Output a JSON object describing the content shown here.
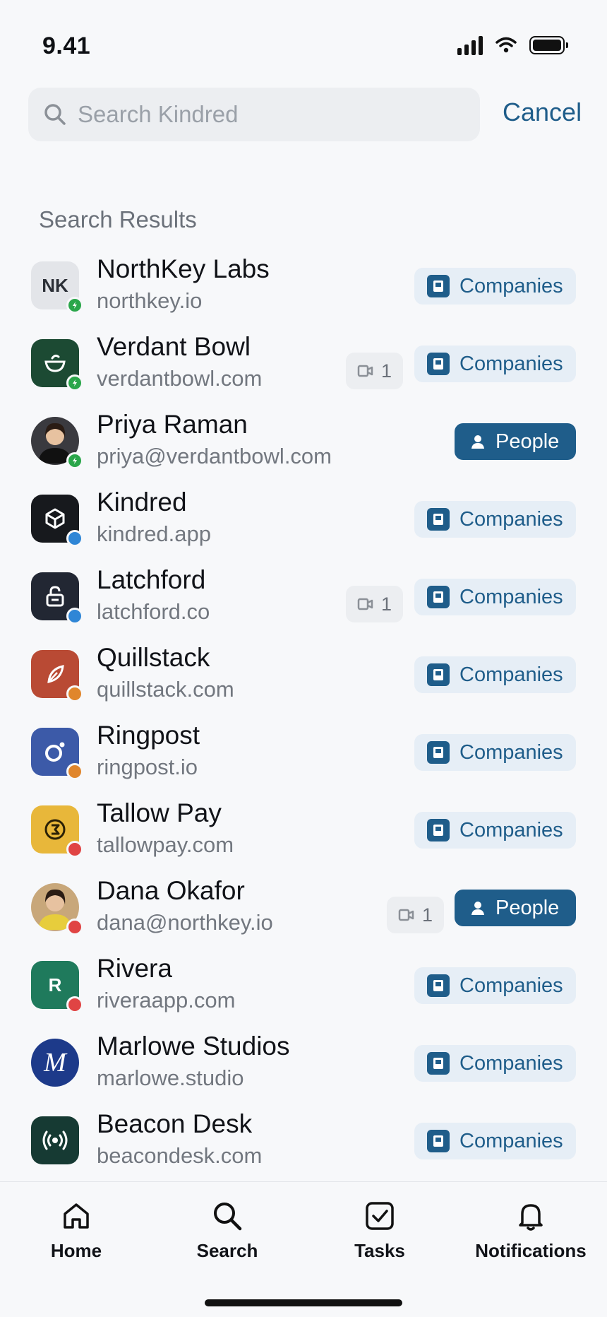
{
  "status_bar": {
    "time": "9.41"
  },
  "search": {
    "placeholder": "Search Kindred",
    "value": "",
    "cancel_label": "Cancel"
  },
  "section_title": "Search Results",
  "results": [
    {
      "title": "NorthKey Labs",
      "subtitle": "northkey.io",
      "tag": "Companies",
      "tag_type": "companies",
      "count": null,
      "avatar_text": "NK",
      "avatar_bg": "#e3e5e9",
      "status": "green"
    },
    {
      "title": "Verdant Bowl",
      "subtitle": "verdantbowl.com",
      "tag": "Companies",
      "tag_type": "companies",
      "count": "1",
      "avatar_icon": "bowl-icon",
      "avatar_bg": "#1c4a33",
      "status": "green"
    },
    {
      "title": "Priya Raman",
      "subtitle": "priya@verdantbowl.com",
      "tag": "People",
      "tag_type": "people",
      "count": null,
      "avatar_icon": "person-photo",
      "avatar_bg": "#3a3a3f",
      "status": "green"
    },
    {
      "title": "Kindred",
      "subtitle": "kindred.app",
      "tag": "Companies",
      "tag_type": "companies",
      "count": null,
      "avatar_icon": "cube-icon",
      "avatar_bg": "#17191d",
      "status": "blue"
    },
    {
      "title": "Latchford",
      "subtitle": "latchford.co",
      "tag": "Companies",
      "tag_type": "companies",
      "count": "1",
      "avatar_icon": "lock-icon",
      "avatar_bg": "#222733",
      "status": "blue"
    },
    {
      "title": "Quillstack",
      "subtitle": "quillstack.com",
      "tag": "Companies",
      "tag_type": "companies",
      "count": null,
      "avatar_icon": "quill-icon",
      "avatar_bg": "#b94a34",
      "status": "orange"
    },
    {
      "title": "Ringpost",
      "subtitle": "ringpost.io",
      "tag": "Companies",
      "tag_type": "companies",
      "count": null,
      "avatar_icon": "ring-icon",
      "avatar_bg": "#3c5aa8",
      "status": "orange"
    },
    {
      "title": "Tallow Pay",
      "subtitle": "tallowpay.com",
      "tag": "Companies",
      "tag_type": "companies",
      "count": null,
      "avatar_icon": "coin-icon",
      "avatar_bg": "#e8b73a",
      "status": "red"
    },
    {
      "title": "Dana Okafor",
      "subtitle": "dana@northkey.io",
      "tag": "People",
      "tag_type": "people",
      "count": "1",
      "avatar_icon": "person-photo",
      "avatar_bg": "#c8a77a",
      "status": "red"
    },
    {
      "title": "Rivera",
      "subtitle": "riveraapp.com",
      "tag": "Companies",
      "tag_type": "companies",
      "count": null,
      "avatar_text": "R",
      "avatar_bg": "#1f7a5c",
      "status": "red"
    },
    {
      "title": "Marlowe Studios",
      "subtitle": "marlowe.studio",
      "tag": "Companies",
      "tag_type": "companies",
      "count": null,
      "avatar_text": "M",
      "avatar_bg": "#1d3a8a",
      "status": null
    },
    {
      "title": "Beacon Desk",
      "subtitle": "beacondesk.com",
      "tag": "Companies",
      "tag_type": "companies",
      "count": null,
      "avatar_icon": "broadcast-icon",
      "avatar_bg": "#163a33",
      "status": null
    }
  ],
  "status_colors": {
    "green": "#2aa64a",
    "blue": "#2f86d6",
    "orange": "#e0862c",
    "red": "#e04444"
  },
  "tabs": [
    {
      "label": "Home",
      "icon": "home-icon"
    },
    {
      "label": "Search",
      "icon": "search-icon"
    },
    {
      "label": "Tasks",
      "icon": "checkbox-icon"
    },
    {
      "label": "Notifications",
      "icon": "bell-icon"
    }
  ],
  "accent": "#1f5d8a"
}
